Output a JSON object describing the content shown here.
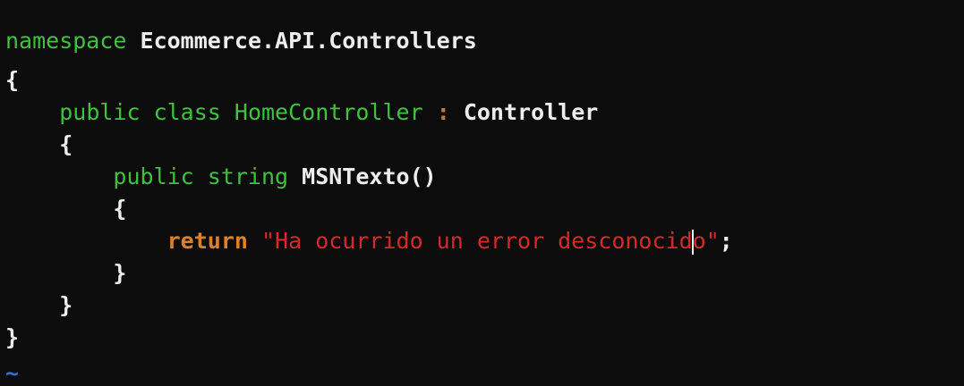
{
  "code": {
    "line1": {
      "keyword": "namespace",
      "name": "Ecommerce.API.Controllers"
    },
    "line2": {
      "brace": "{"
    },
    "line3": {
      "modifiers": "public class",
      "class_name": "HomeController",
      "colon": ":",
      "base": "Controller"
    },
    "line4": {
      "brace": "{"
    },
    "line5": {
      "modifiers": "public string",
      "method": "MSNTexto()"
    },
    "line6": {
      "brace": "{"
    },
    "line7": {
      "keyword": "return",
      "string_before_cursor": "\"Ha ocurrido un error desconocid",
      "string_after_cursor": "o\"",
      "terminator": ";"
    },
    "line8": {
      "brace": "}"
    },
    "line9": {
      "brace": "}"
    },
    "line10": {
      "brace": "}"
    },
    "line11": {
      "marker": "~"
    }
  },
  "colors": {
    "background": "#0c0c0c",
    "keyword": "#3fc23f",
    "identifier": "#eeeeee",
    "return_keyword": "#d9822b",
    "string": "#d42a2a",
    "tilde": "#2f6fd6"
  }
}
